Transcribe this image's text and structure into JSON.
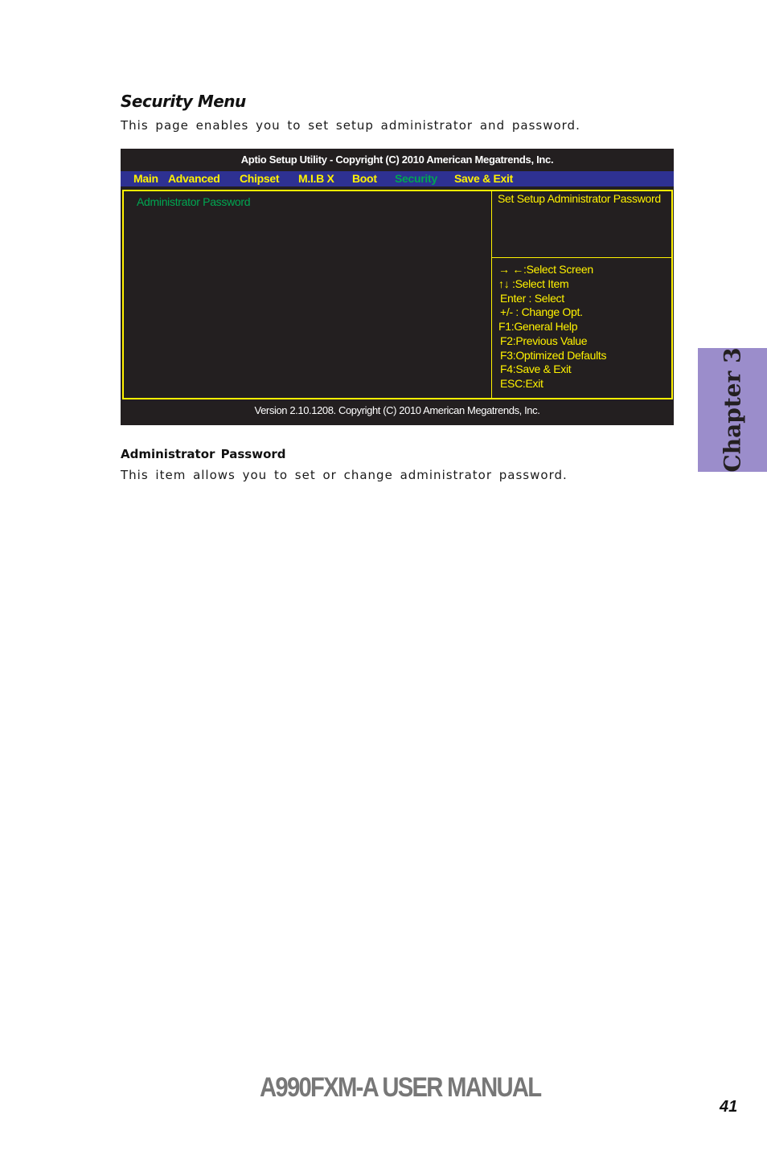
{
  "section": {
    "title": "Security Menu",
    "intro": "This page enables you to set setup administrator and password."
  },
  "bios": {
    "title": "Aptio Setup Utility - Copyright (C) 2010 American Megatrends, Inc.",
    "menu": [
      {
        "label": "Main",
        "active": false
      },
      {
        "label": "Advanced",
        "active": false
      },
      {
        "label": "Chipset",
        "active": false
      },
      {
        "label": "M.I.B X",
        "active": false
      },
      {
        "label": "Boot",
        "active": false
      },
      {
        "label": "Security",
        "active": true
      },
      {
        "label": "Save & Exit",
        "active": false
      }
    ],
    "items": [
      {
        "label": "Administrator Password",
        "selected": true
      }
    ],
    "help_text": "Set Setup Administrator Password",
    "keys": [
      {
        "icon": "left-right-arrows-icon",
        "glyph": "→ ←",
        "label": ":Select Screen"
      },
      {
        "icon": "up-down-arrows-icon",
        "glyph": "↑↓",
        "label": " :Select Item"
      },
      {
        "label": "Enter : Select"
      },
      {
        "label": "+/-  : Change Opt."
      },
      {
        "label": "F1:General Help"
      },
      {
        "label": "F2:Previous Value"
      },
      {
        "label": "F3:Optimized Defaults"
      },
      {
        "label": "F4:Save & Exit"
      },
      {
        "label": "ESC:Exit"
      }
    ],
    "footer": "Version 2.10.1208. Copyright (C) 2010  American Megatrends, Inc.",
    "colors": {
      "background": "#231f20",
      "menubar": "#2e3192",
      "text_yellow": "#fff200",
      "selected_green": "#00a651",
      "white": "#ffffff"
    }
  },
  "subsection": {
    "title": "Administrator  Password",
    "text": "This item allows you to set or change administrator password."
  },
  "chapter_tab": {
    "label": "Chapter 3",
    "color": "#9b8dcb"
  },
  "footer": {
    "manual_title": "A990FXM-A USER MANUAL",
    "page_number": "41"
  }
}
